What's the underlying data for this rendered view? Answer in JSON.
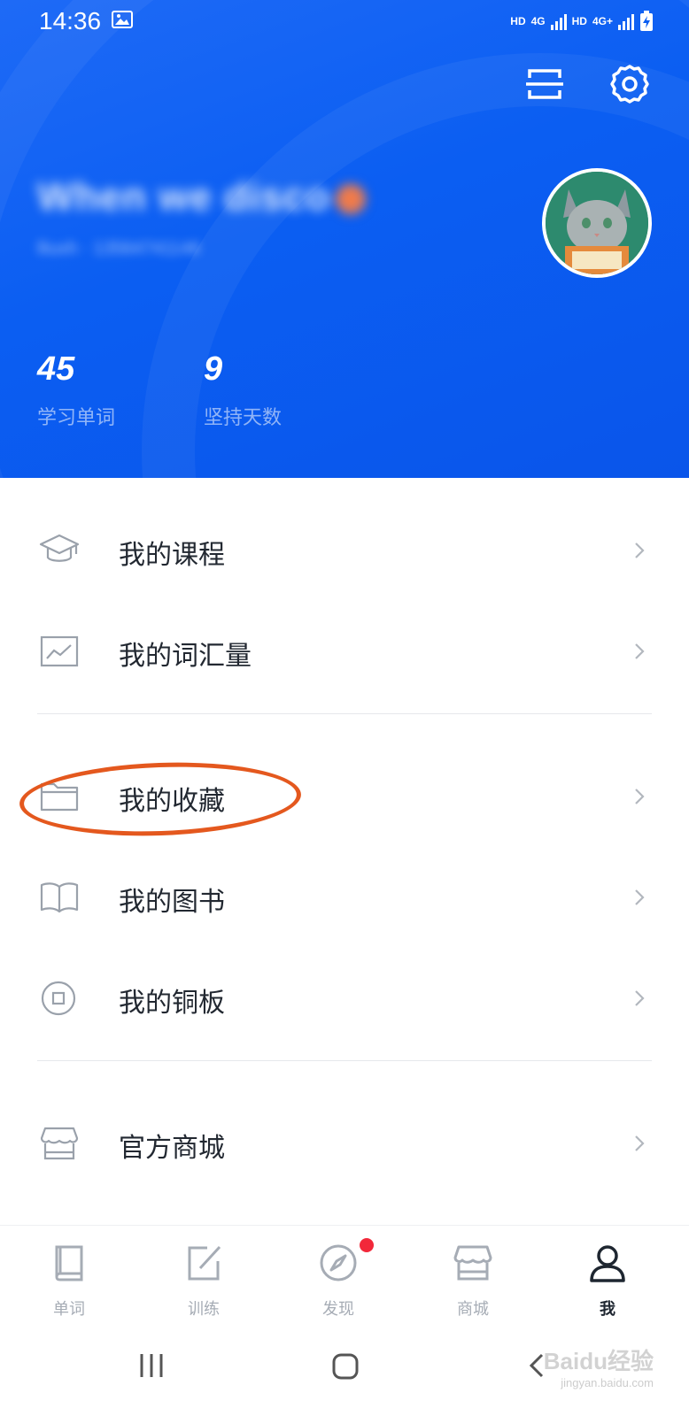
{
  "status_bar": {
    "time": "14:36",
    "network_labels": [
      "HD",
      "4G",
      "HD",
      "4G+"
    ]
  },
  "header": {
    "username": "When we disco",
    "user_subtitle": "lliuxh · 13564741146",
    "stats": [
      {
        "value": "45",
        "label": "学习单词"
      },
      {
        "value": "9",
        "label": "坚持天数"
      }
    ],
    "icons": [
      "scan-icon",
      "gear-icon"
    ]
  },
  "menu": {
    "items": [
      {
        "label": "我的课程",
        "icon": "graduation-cap-icon"
      },
      {
        "label": "我的词汇量",
        "icon": "chart-icon"
      },
      {
        "label": "我的收藏",
        "icon": "folder-icon"
      },
      {
        "label": "我的图书",
        "icon": "book-open-icon"
      },
      {
        "label": "我的铜板",
        "icon": "coin-icon"
      },
      {
        "label": "官方商城",
        "icon": "store-icon"
      }
    ]
  },
  "bottom_nav": {
    "items": [
      {
        "label": "单词",
        "icon": "book-icon"
      },
      {
        "label": "训练",
        "icon": "edit-icon"
      },
      {
        "label": "发现",
        "icon": "compass-icon"
      },
      {
        "label": "商城",
        "icon": "store-icon"
      },
      {
        "label": "我",
        "icon": "person-icon"
      }
    ],
    "active_index": 4
  },
  "watermark": {
    "brand": "Baidu经验",
    "site": "jingyan.baidu.com"
  },
  "colors": {
    "header_blue": "#0b5ef2",
    "annotation": "#e4581e",
    "badge_red": "#f2283a"
  }
}
